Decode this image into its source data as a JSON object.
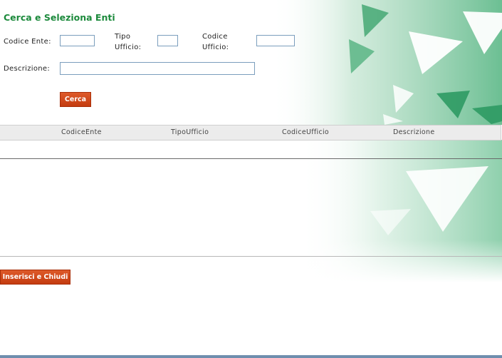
{
  "page": {
    "title": "Cerca e Seleziona Enti"
  },
  "form": {
    "codice_ente_label": "Codice Ente:",
    "codice_ente_value": "",
    "tipo_label_line1": "Tipo",
    "tipo_label_line2": "Ufficio:",
    "tipo_value": "",
    "codice_ufficio_label_line1": "Codice",
    "codice_ufficio_label_line2": "Ufficio:",
    "codice_ufficio_value": "",
    "descrizione_label": "Descrizione:",
    "descrizione_value": "",
    "search_button": "Cerca"
  },
  "grid": {
    "columns": [
      "CodiceEnte",
      "TipoUfficio",
      "CodiceUfficio",
      "Descrizione"
    ],
    "rows": []
  },
  "footer": {
    "insert_close_button": "Inserisci e Chiudi"
  },
  "colors": {
    "title": "#1c8a3c",
    "button": "#c94216",
    "decoration_green": "#2e9a63"
  }
}
